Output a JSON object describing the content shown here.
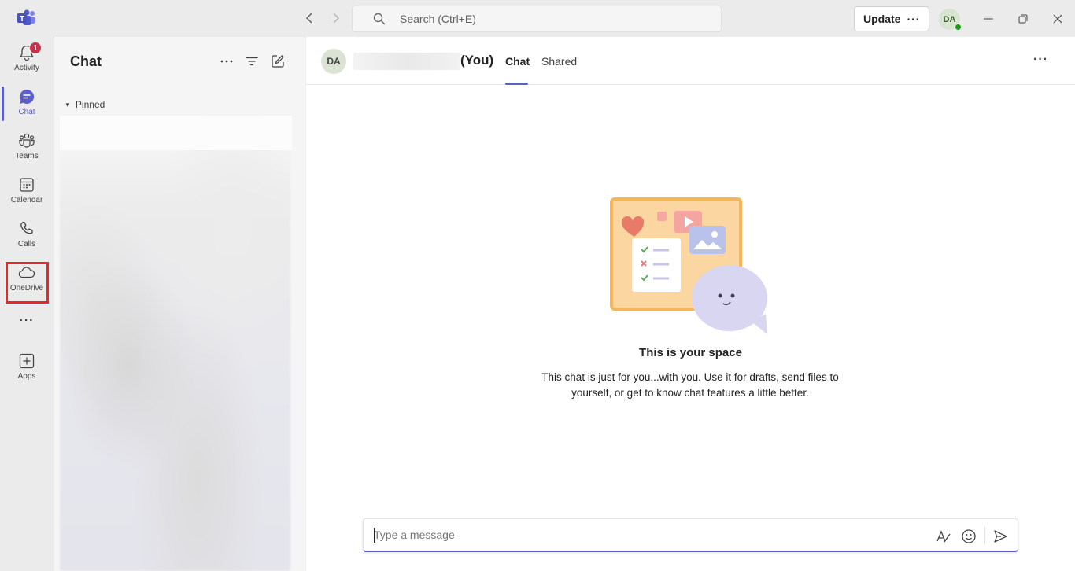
{
  "titlebar": {
    "search_placeholder": "Search (Ctrl+E)",
    "update_label": "Update",
    "update_more": "···",
    "user_initials": "DA"
  },
  "rail": {
    "items": [
      {
        "label": "Activity",
        "icon": "bell-icon",
        "badge": "1"
      },
      {
        "label": "Chat",
        "icon": "chat-icon"
      },
      {
        "label": "Teams",
        "icon": "teams-icon"
      },
      {
        "label": "Calendar",
        "icon": "calendar-icon"
      },
      {
        "label": "Calls",
        "icon": "phone-icon"
      },
      {
        "label": "OneDrive",
        "icon": "cloud-icon"
      },
      {
        "label": "Apps",
        "icon": "add-app-icon"
      }
    ],
    "more": "···",
    "active_color": "#5b5fc7",
    "highlight_color": "#e8262b"
  },
  "chatlist": {
    "title": "Chat",
    "section_pinned": "Pinned"
  },
  "main": {
    "avatar_initials": "DA",
    "you_suffix": "(You)",
    "tabs": [
      {
        "label": "Chat",
        "active": true
      },
      {
        "label": "Shared",
        "active": false
      }
    ],
    "more": "···",
    "empty_title": "This is your space",
    "empty_desc": "This chat is just for you...with you. Use it for drafts, send files to yourself, or get to know chat features a little better.",
    "composer_placeholder": "Type a message"
  }
}
